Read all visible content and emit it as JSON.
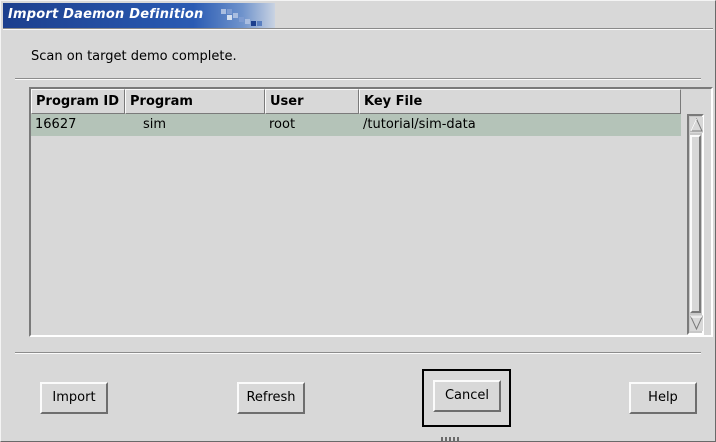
{
  "window": {
    "title": "Import Daemon Definition"
  },
  "status_message": "Scan on target demo complete.",
  "table": {
    "columns": [
      "Program ID",
      "Program",
      "User",
      "Key File"
    ],
    "rows": [
      {
        "program_id": "16627",
        "program": "sim",
        "user": "root",
        "key_file": "/tutorial/sim-data",
        "selected": true
      }
    ]
  },
  "buttons": {
    "import": "Import",
    "refresh": "Refresh",
    "cancel": "Cancel",
    "help": "Help"
  },
  "colors": {
    "title_bar": "#2a5bb3",
    "selected_row": "#b4c3b8",
    "window_bg": "#d8d8d8"
  },
  "icons": {
    "title_decoration": "window-grid-icon",
    "scroll_up": "scroll-up-arrow-icon",
    "scroll_down": "scroll-down-arrow-icon"
  }
}
